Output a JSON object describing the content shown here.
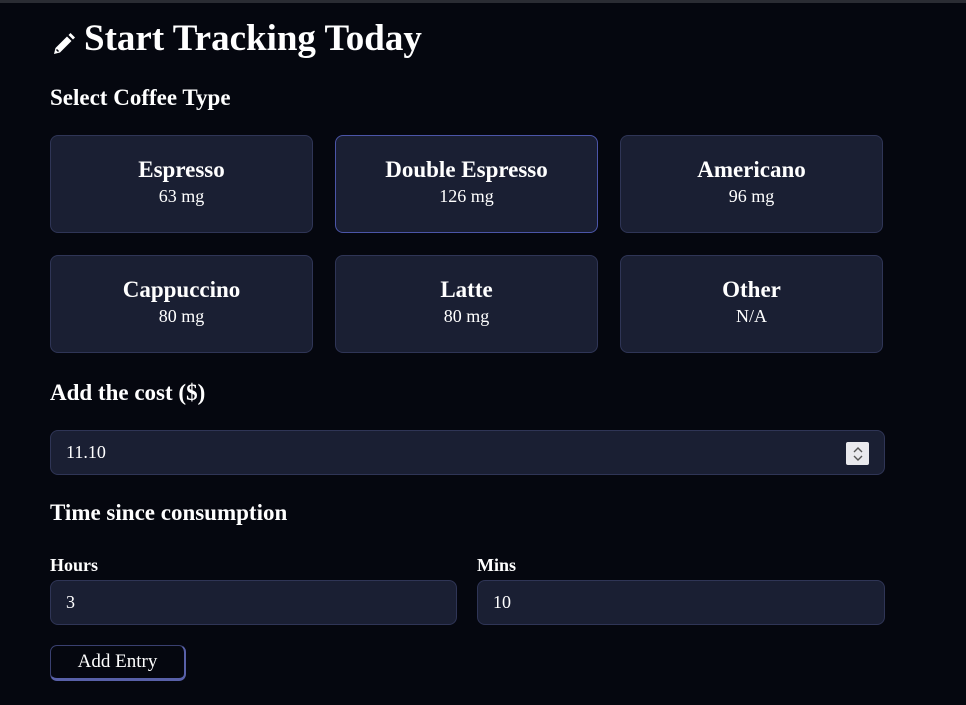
{
  "header": {
    "title": "Start Tracking Today",
    "icon": "pencil-icon"
  },
  "coffee_section": {
    "label": "Select Coffee Type",
    "types": [
      {
        "name": "Espresso",
        "caffeine": "63 mg",
        "selected": false
      },
      {
        "name": "Double Espresso",
        "caffeine": "126 mg",
        "selected": true
      },
      {
        "name": "Americano",
        "caffeine": "96 mg",
        "selected": false
      },
      {
        "name": "Cappuccino",
        "caffeine": "80 mg",
        "selected": false
      },
      {
        "name": "Latte",
        "caffeine": "80 mg",
        "selected": false
      },
      {
        "name": "Other",
        "caffeine": "N/A",
        "selected": false
      }
    ]
  },
  "cost": {
    "label": "Add the cost ($)",
    "value": "11.10"
  },
  "time": {
    "label": "Time since consumption",
    "hours_label": "Hours",
    "hours_value": "3",
    "mins_label": "Mins",
    "mins_value": "10"
  },
  "actions": {
    "add_label": "Add Entry"
  },
  "colors": {
    "background": "#05070f",
    "card": "#1a1f33",
    "border": "#2f3556",
    "accent": "#5860a8"
  }
}
